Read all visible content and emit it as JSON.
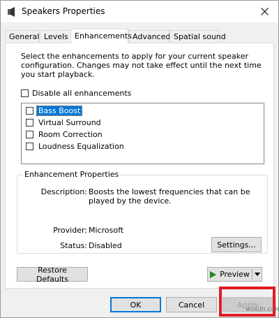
{
  "window": {
    "title": "Speakers Properties"
  },
  "tabs": [
    {
      "label": "General"
    },
    {
      "label": "Levels"
    },
    {
      "label": "Enhancements"
    },
    {
      "label": "Advanced"
    },
    {
      "label": "Spatial sound"
    }
  ],
  "active_tab": "Enhancements",
  "enhancements": {
    "description": "Select the enhancements to apply for your current speaker configuration. Changes may not take effect until the next time you start playback.",
    "disable_all_label": "Disable all enhancements",
    "items": [
      {
        "label": "Bass Boost",
        "checked": false,
        "selected": true
      },
      {
        "label": "Virtual Surround",
        "checked": false,
        "selected": false
      },
      {
        "label": "Room Correction",
        "checked": false,
        "selected": false
      },
      {
        "label": "Loudness Equalization",
        "checked": false,
        "selected": false
      }
    ],
    "properties": {
      "group_title": "Enhancement Properties",
      "description_label": "Description:",
      "description_value": "Boosts the lowest frequencies that can be played by the device.",
      "provider_label": "Provider:",
      "provider_value": "Microsoft",
      "status_label": "Status:",
      "status_value": "Disabled",
      "settings_button": "Settings..."
    },
    "restore_defaults_button": "Restore Defaults",
    "preview_button": "Preview"
  },
  "footer": {
    "ok_button": "OK",
    "cancel_button": "Cancel",
    "apply_button": "Apply"
  },
  "watermark": "wsxdn.com",
  "colors": {
    "selection": "#0078d7",
    "highlight_box": "#e01b24",
    "play_icon": "#1a8a1a"
  }
}
